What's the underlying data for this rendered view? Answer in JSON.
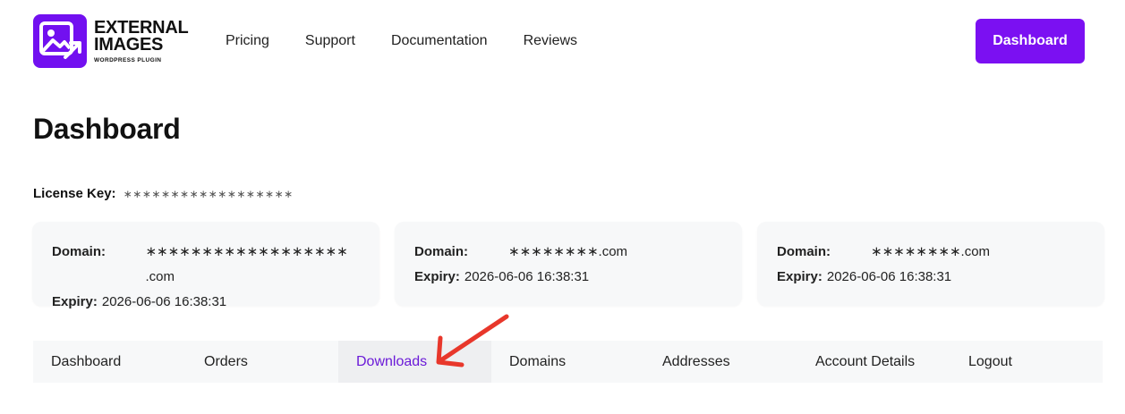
{
  "brand": {
    "line1": "EXTERNAL",
    "line2": "IMAGES",
    "sub": "WORDPRESS PLUGIN",
    "accent": "#7b10f2"
  },
  "nav": {
    "items": [
      "Pricing",
      "Support",
      "Documentation",
      "Reviews"
    ]
  },
  "header_button": "Dashboard",
  "page_title": "Dashboard",
  "license": {
    "label": "License Key:",
    "value": "∗∗∗∗∗∗∗∗∗∗∗∗∗∗∗∗∗∗"
  },
  "cards": [
    {
      "domain_label": "Domain:",
      "domain": "∗∗∗∗∗∗∗∗∗∗∗∗∗∗∗∗∗∗ .com",
      "expiry_label": "Expiry:",
      "expiry": "2026-06-06 16:38:31"
    },
    {
      "domain_label": "Domain:",
      "domain": "∗∗∗∗∗∗∗∗.com",
      "expiry_label": "Expiry:",
      "expiry": "2026-06-06 16:38:31"
    },
    {
      "domain_label": "Domain:",
      "domain": "∗∗∗∗∗∗∗∗.com",
      "expiry_label": "Expiry:",
      "expiry": "2026-06-06 16:38:31"
    }
  ],
  "tabs": [
    "Dashboard",
    "Orders",
    "Downloads",
    "Domains",
    "Addresses",
    "Account Details",
    "Logout"
  ],
  "active_tab": "Downloads",
  "colors": {
    "tab_active_text": "#6b1ad8",
    "arrow": "#e8372b"
  }
}
